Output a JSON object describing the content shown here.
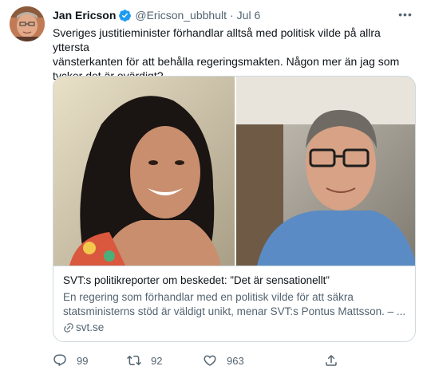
{
  "tweet": {
    "author": {
      "display_name": "Jan Ericson",
      "handle": "@Ericson_ubbhult",
      "verified_icon": "verified-badge-icon"
    },
    "separator": "·",
    "date": "Jul 6",
    "text": "Sveriges justitieminister förhandlar alltså med politisk vilde på allra yttersta\nvänsterkanten för att behålla regeringsmakten. Någon mer än jag som\ntycker det är ovärdigt?",
    "card": {
      "title": "SVT:s politikreporter om beskedet: ”Det är sensationellt”",
      "description": "En regering som förhandlar med en politisk vilde för att säkra\nstatsministerns stöd är väldigt unikt, menar SVT:s Pontus Mattsson. – ...",
      "domain": "svt.se",
      "link_icon": "link-icon"
    },
    "actions": {
      "reply": {
        "icon": "reply-icon",
        "count": "99"
      },
      "retweet": {
        "icon": "retweet-icon",
        "count": "92"
      },
      "like": {
        "icon": "heart-icon",
        "count": "963"
      },
      "share": {
        "icon": "share-icon"
      }
    },
    "more_icon": "more-icon"
  },
  "colors": {
    "text_primary": "#0f1419",
    "text_secondary": "#536471",
    "verified_blue": "#1d9bf0",
    "border": "#cfd9de"
  }
}
